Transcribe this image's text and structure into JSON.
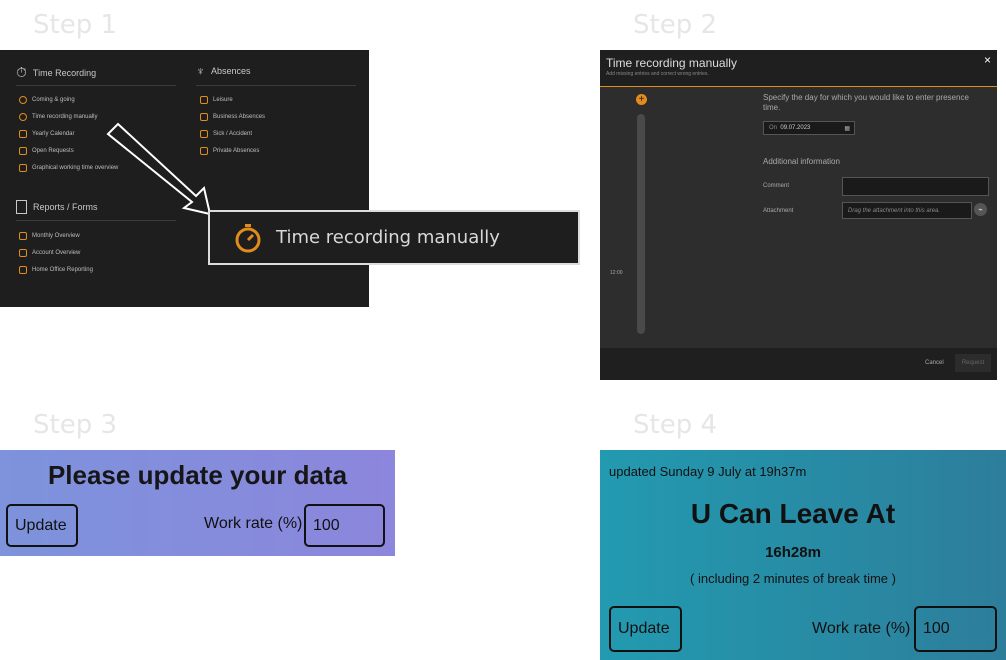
{
  "steps": {
    "s1": "Step 1",
    "s2": "Step 2",
    "s3": "Step 3",
    "s4": "Step 4"
  },
  "step1": {
    "time_recording": {
      "title": "Time Recording",
      "items": [
        "Coming & going",
        "Time recording manually",
        "Yearly Calendar",
        "Open Requests",
        "Graphical working time overview"
      ]
    },
    "absences": {
      "title": "Absences",
      "items": [
        "Leisure",
        "Business Absences",
        "Sick / Accident",
        "Private Absences"
      ]
    },
    "reports": {
      "title": "Reports / Forms",
      "items": [
        "Monthly Overview",
        "Account Overview",
        "Home Office Reporting"
      ]
    },
    "popup_label": "Time recording manually",
    "accent_color": "#e38b1c"
  },
  "step2": {
    "title": "Time recording manually",
    "subtitle": "Add missing entries and correct wrong entries.",
    "instruction": "Specify the day for which you would like to enter presence time.",
    "date_prefix": "On",
    "date_value": "09.07.2023",
    "additional": "Additional information",
    "comment_label": "Comment",
    "attachment_label": "Attachment",
    "attachment_placeholder": "Drag the attachment into this area.",
    "time_tick": "12:00",
    "cancel": "Cancel",
    "request": "Request",
    "close": "×"
  },
  "step3": {
    "heading": "Please update your data",
    "update": "Update",
    "workrate_label": "Work rate (%)",
    "workrate_value": "100"
  },
  "step4": {
    "updated": "updated Sunday 9 July at 19h37m",
    "heading": "U Can Leave At",
    "time": "16h28m",
    "note": "( including 2 minutes of break time )",
    "update": "Update",
    "workrate_label": "Work rate (%)",
    "workrate_value": "100"
  }
}
